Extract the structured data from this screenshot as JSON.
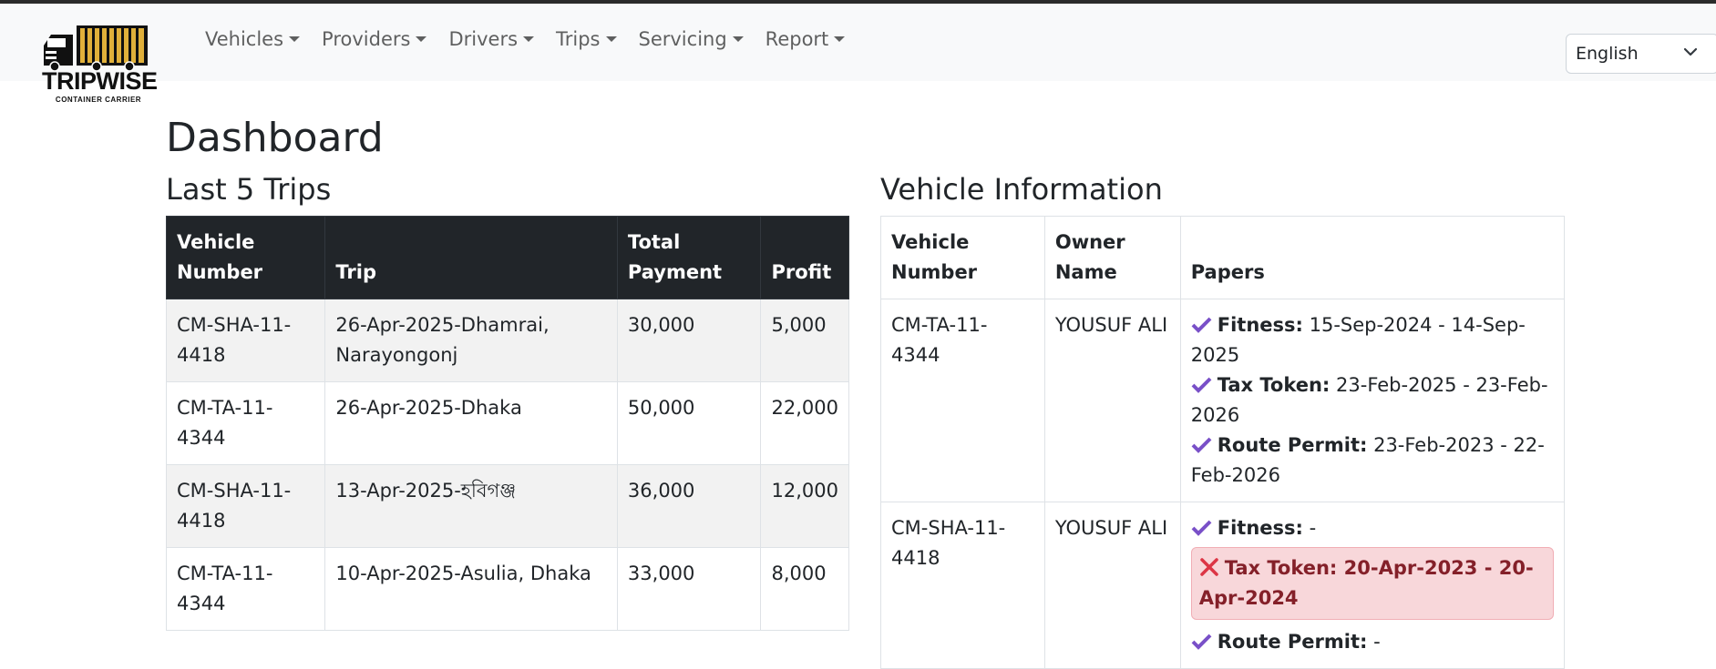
{
  "brand": {
    "name": "TRIPWISE",
    "tagline": "CONTAINER CARRIER"
  },
  "nav": {
    "items": [
      {
        "label": "Vehicles"
      },
      {
        "label": "Providers"
      },
      {
        "label": "Drivers"
      },
      {
        "label": "Trips"
      },
      {
        "label": "Servicing"
      },
      {
        "label": "Report"
      }
    ]
  },
  "language": {
    "selected": "English"
  },
  "page_title": "Dashboard",
  "trips": {
    "heading": "Last 5 Trips",
    "columns": [
      "Vehicle Number",
      "Trip",
      "Total Payment",
      "Profit"
    ],
    "rows": [
      {
        "vehicle": "CM-SHA-11-4418",
        "trip": "26-Apr-2025-Dhamrai, Narayongonj",
        "payment": "30,000",
        "profit": "5,000"
      },
      {
        "vehicle": "CM-TA-11-4344",
        "trip": "26-Apr-2025-Dhaka",
        "payment": "50,000",
        "profit": "22,000"
      },
      {
        "vehicle": "CM-SHA-11-4418",
        "trip": "13-Apr-2025-হবিগঞ্জ",
        "payment": "36,000",
        "profit": "12,000"
      },
      {
        "vehicle": "CM-TA-11-4344",
        "trip": "10-Apr-2025-Asulia, Dhaka",
        "payment": "33,000",
        "profit": "8,000"
      }
    ]
  },
  "vehicle_info": {
    "heading": "Vehicle Information",
    "columns": [
      "Vehicle Number",
      "Owner Name",
      "Papers"
    ],
    "rows": [
      {
        "vehicle": "CM-TA-11-4344",
        "owner": "YOUSUF ALI",
        "papers": [
          {
            "label": "Fitness:",
            "value": "15-Sep-2024 - 14-Sep-2025"
          },
          {
            "label": "Tax Token:",
            "value": "23-Feb-2025 - 23-Feb-2026"
          },
          {
            "label": "Route Permit:",
            "value": "23-Feb-2023 - 22-Feb-2026"
          }
        ]
      },
      {
        "vehicle": "CM-SHA-11-4418",
        "owner": "YOUSUF ALI",
        "papers": [
          {
            "label": "Fitness:",
            "value": "-"
          },
          {
            "label": "Tax Token:",
            "value": "20-Apr-2023 - 20-Apr-2024",
            "expired": true
          },
          {
            "label": "Route Permit:",
            "value": "-"
          }
        ]
      }
    ]
  },
  "colors": {
    "check": "#7950c8",
    "expired_bg": "#f8d7da",
    "expired_text": "#842029",
    "expired_icon": "#dc3545",
    "table_header_dark": "#212529"
  }
}
